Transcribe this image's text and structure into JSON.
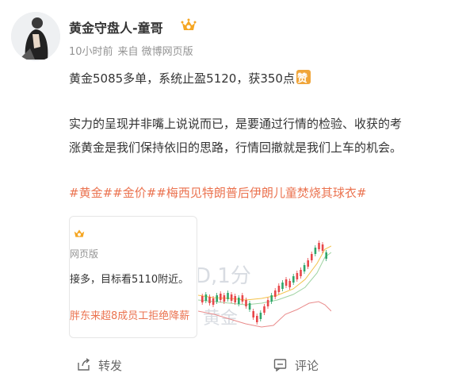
{
  "author": {
    "name": "黄金守盘人-童哥",
    "time": "10小时前",
    "source": "来自 微博网页版"
  },
  "post": {
    "line1": "黄金5085多单，系统止盈5120，获350点",
    "line2": "实力的呈现并非嘴上说说而已，是要通过行情的检验、收获的考",
    "line3": "涨黄金是我们保持依旧的思路，行情回撤就是我们上车的机会。",
    "hashtags": "#黄金##金价##梅西见特朗普后伊朗儿童焚烧其球衣#"
  },
  "card": {
    "source": "网页版",
    "text": "接多，目标看5110附近。",
    "link": "胖东来超8成员工拒绝降薪"
  },
  "chart_image": {
    "watermark1": "D,1分",
    "watermark2": "黄金"
  },
  "actions": {
    "share": "转发",
    "comment": "评论"
  },
  "colors": {
    "hashtag": "#eb7350",
    "meta": "#939393"
  }
}
